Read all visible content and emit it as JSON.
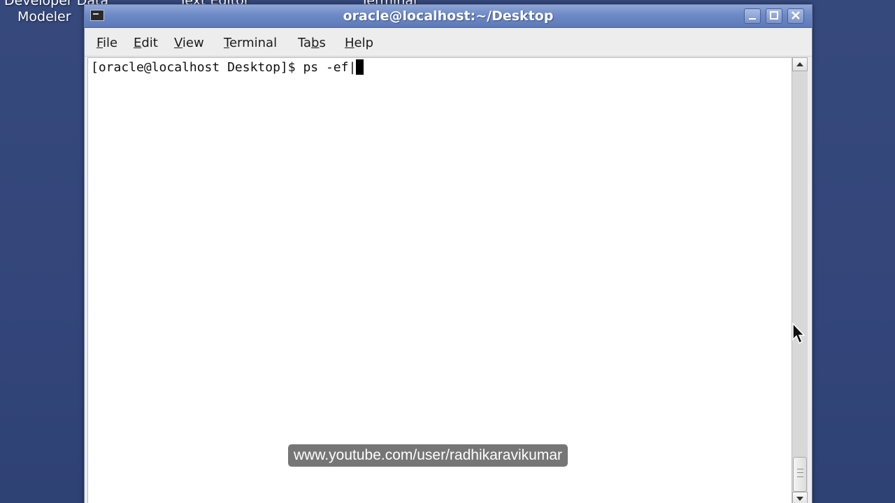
{
  "desktop": {
    "icons": [
      {
        "label": "Developer Data"
      },
      {
        "label": "Modeler"
      },
      {
        "label": "Text Editor"
      },
      {
        "label": "Terminal"
      }
    ],
    "background_color": "#34467a"
  },
  "window": {
    "title": "oracle@localhost:~/Desktop",
    "controls": {
      "minimize": "minimize",
      "maximize": "maximize",
      "close": "close"
    }
  },
  "menu": {
    "items": [
      {
        "before": "",
        "mnemonic": "F",
        "after": "ile"
      },
      {
        "before": "",
        "mnemonic": "E",
        "after": "dit"
      },
      {
        "before": "",
        "mnemonic": "V",
        "after": "iew"
      },
      {
        "before": "",
        "mnemonic": "T",
        "after": "erminal"
      },
      {
        "before": "Ta",
        "mnemonic": "b",
        "after": "s"
      },
      {
        "before": "",
        "mnemonic": "H",
        "after": "elp"
      }
    ]
  },
  "terminal": {
    "prompt": "[oracle@localhost Desktop]$ ",
    "command": "ps -ef|"
  },
  "watermark": {
    "text": "www.youtube.com/user/radhikaravikumar"
  }
}
